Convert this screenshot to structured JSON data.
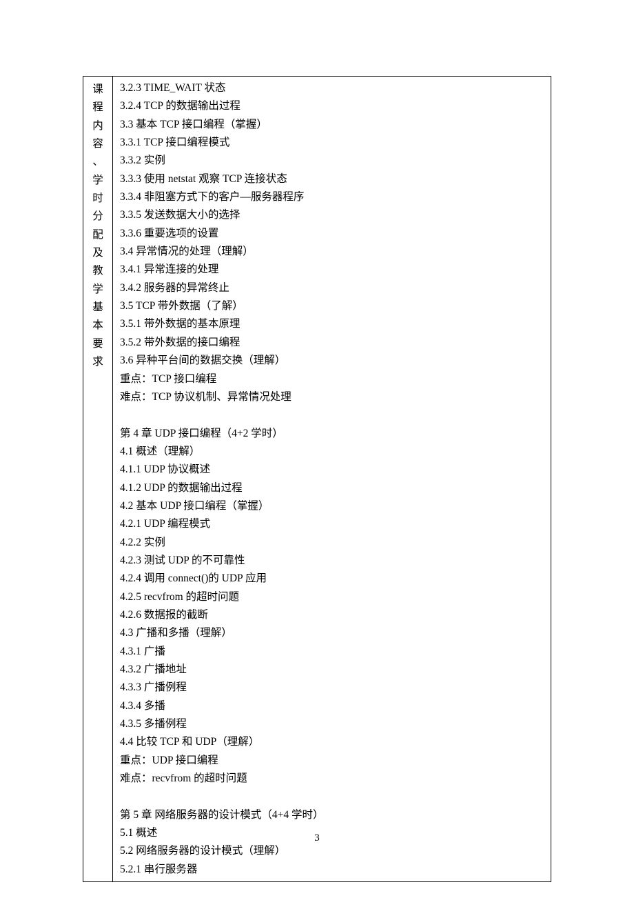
{
  "label_chars": [
    "课",
    "程",
    "内",
    "容",
    "、",
    "学",
    "时",
    "分",
    "配",
    "及",
    "教",
    "学",
    "基",
    "本",
    "要",
    "求"
  ],
  "lines": [
    "3.2.3 TIME_WAIT 状态",
    "3.2.4 TCP 的数据输出过程",
    "3.3 基本 TCP 接口编程（掌握）",
    "3.3.1 TCP 接口编程模式",
    "3.3.2 实例",
    "3.3.3 使用 netstat 观察 TCP 连接状态",
    "3.3.4 非阻塞方式下的客户—服务器程序",
    "3.3.5 发送数据大小的选择",
    "3.3.6 重要选项的设置",
    "3.4 异常情况的处理（理解）",
    "3.4.1 异常连接的处理",
    "3.4.2 服务器的异常终止",
    "3.5 TCP 带外数据（了解）",
    "3.5.1 带外数据的基本原理",
    "3.5.2 带外数据的接口编程",
    "3.6 异种平台间的数据交换（理解）",
    "重点：TCP 接口编程",
    "难点：TCP 协议机制、异常情况处理",
    "",
    "第 4 章 UDP 接口编程（4+2 学时）",
    "4.1 概述（理解）",
    "4.1.1 UDP 协议概述",
    "4.1.2 UDP 的数据输出过程",
    "4.2 基本 UDP 接口编程（掌握）",
    "4.2.1 UDP 编程模式",
    "4.2.2 实例",
    "4.2.3 测试 UDP 的不可靠性",
    "4.2.4 调用 connect()的 UDP 应用",
    "4.2.5 recvfrom 的超时问题",
    "4.2.6 数据报的截断",
    "4.3 广播和多播（理解）",
    "4.3.1 广播",
    "4.3.2 广播地址",
    "4.3.3 广播例程",
    "4.3.4 多播",
    "4.3.5 多播例程",
    "4.4 比较 TCP 和 UDP（理解）",
    "重点：UDP 接口编程",
    "难点：recvfrom 的超时问题",
    "",
    "第 5 章 网络服务器的设计模式（4+4 学时）",
    "5.1 概述",
    "5.2 网络服务器的设计模式（理解）",
    "5.2.1 串行服务器"
  ],
  "page_number": "3"
}
